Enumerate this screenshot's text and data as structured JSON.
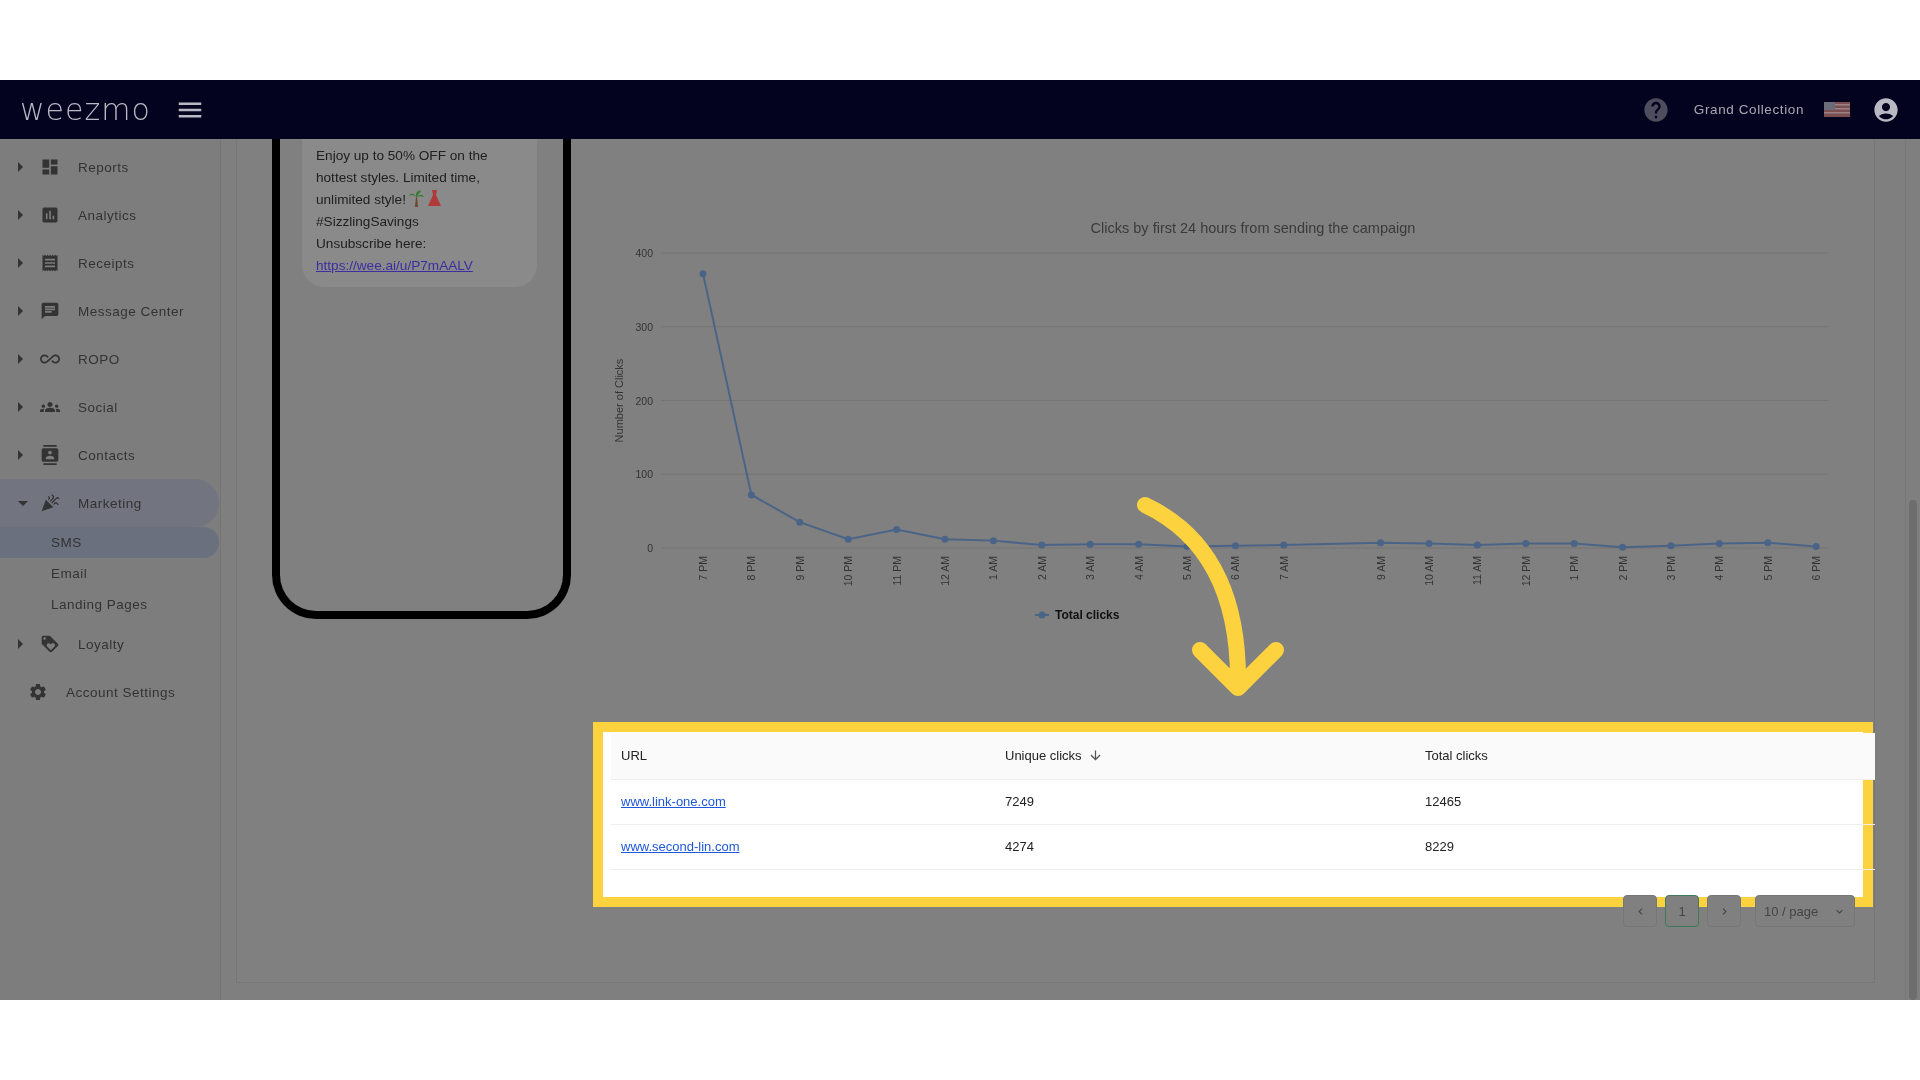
{
  "header": {
    "logo": "weezmo",
    "account_name": "Grand Collection"
  },
  "sidebar": {
    "items": [
      {
        "kind": "group",
        "label": "Reports",
        "expanded": false
      },
      {
        "kind": "group",
        "label": "Analytics",
        "expanded": false
      },
      {
        "kind": "group",
        "label": "Receipts",
        "expanded": false
      },
      {
        "kind": "group",
        "label": "Message Center",
        "expanded": false
      },
      {
        "kind": "group",
        "label": "ROPO",
        "expanded": false
      },
      {
        "kind": "group",
        "label": "Social",
        "expanded": false
      },
      {
        "kind": "group",
        "label": "Contacts",
        "expanded": false
      },
      {
        "kind": "group",
        "label": "Marketing",
        "expanded": true,
        "children": [
          {
            "label": "SMS",
            "selected": true
          },
          {
            "label": "Email",
            "selected": false
          },
          {
            "label": "Landing Pages",
            "selected": false
          }
        ]
      },
      {
        "kind": "group",
        "label": "Loyalty",
        "expanded": false
      },
      {
        "kind": "link",
        "label": "Account Settings"
      }
    ]
  },
  "phone_preview": {
    "message": "Enjoy up to 50% OFF on the hottest styles. Limited time, unlimited style!",
    "hashtag": "#SizzlingSavings",
    "unsubscribe_text": "Unsubscribe here:",
    "unsubscribe_link": "https://wee.ai/u/P7mAALV"
  },
  "chart": {
    "chart_data": {
      "type": "line",
      "title": "Clicks by first 24 hours from sending the campaign",
      "ylabel": "Number of Clicks",
      "categories": [
        "7 PM",
        "8 PM",
        "9 PM",
        "10 PM",
        "11 PM",
        "12 AM",
        "1 AM",
        "2 AM",
        "3 AM",
        "4 AM",
        "5 AM",
        "6 AM",
        "7 AM",
        null,
        "9 AM",
        "10 AM",
        "11 AM",
        "12 PM",
        "1 PM",
        "2 PM",
        "3 PM",
        "4 PM",
        "5 PM",
        "6 PM"
      ],
      "grid": true,
      "ylim": [
        0,
        400
      ],
      "yticks": [
        0,
        100,
        200,
        300,
        400
      ],
      "series": [
        {
          "name": "Total clicks",
          "color": "#4a6488",
          "marker": "circle",
          "values": [
            372,
            72,
            35,
            12,
            25,
            12,
            10,
            4,
            5,
            5,
            2,
            3,
            4,
            null,
            7,
            6,
            4,
            6,
            6,
            1,
            3,
            6,
            7,
            2
          ]
        }
      ]
    }
  },
  "table": {
    "columns": [
      {
        "label": "URL",
        "sorted": false
      },
      {
        "label": "Unique clicks",
        "sorted": true
      },
      {
        "label": "Total clicks",
        "sorted": false
      }
    ],
    "rows": [
      {
        "url": "www.link-one.com",
        "unique_clicks": "7249",
        "total_clicks": "12465"
      },
      {
        "url": "www.second-lin.com",
        "unique_clicks": "4274",
        "total_clicks": "8229"
      }
    ]
  },
  "pagination": {
    "pages": [
      {
        "label": "1",
        "selected": true
      }
    ],
    "page_size": "10 / page"
  }
}
